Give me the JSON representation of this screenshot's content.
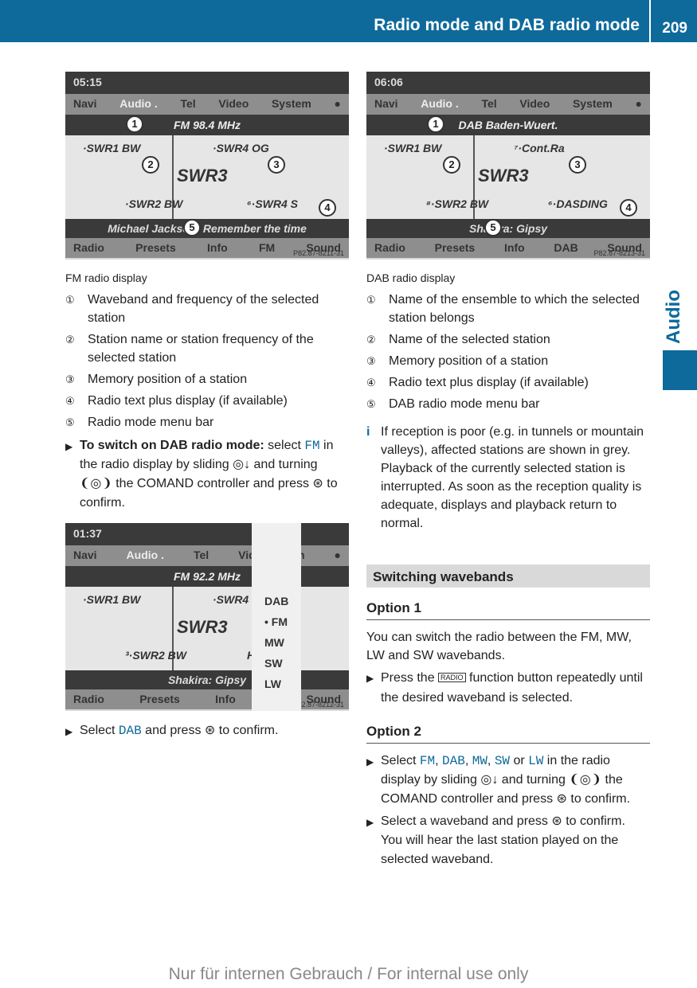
{
  "header": {
    "title": "Radio mode and DAB radio mode",
    "page": "209"
  },
  "side_tab": "Audio",
  "screen_fm": {
    "time": "05:15",
    "nav": [
      "Navi",
      "Audio .",
      "Tel",
      "Video",
      "System"
    ],
    "band": "FM 98.4 MHz",
    "left_top": "·SWR1 BW",
    "right_top": "·SWR4 OG",
    "station": "SWR3",
    "left_bottom": "·SWR2 BW",
    "right_bottom": "⁶·SWR4 S",
    "radiotext": "Michael Jackson: Remember the time",
    "menu": [
      "Radio",
      "Presets",
      "Info",
      "FM",
      "Sound"
    ],
    "code": "P82.87-8211-31"
  },
  "screen_dab": {
    "time": "06:06",
    "nav": [
      "Navi",
      "Audio .",
      "Tel",
      "Video",
      "System"
    ],
    "band": "DAB Baden-Wuert.",
    "left_top": "·SWR1 BW",
    "right_top": "⁷·Cont.Ra",
    "station": "SWR3",
    "left_bottom": "⁸·SWR2 BW",
    "right_bottom": "⁶·DASDING",
    "radiotext": "Shakira: Gipsy",
    "menu": [
      "Radio",
      "Presets",
      "Info",
      "DAB",
      "Sound"
    ],
    "code": "P82.87-8213-31"
  },
  "screen_menu": {
    "time": "01:37",
    "nav": [
      "Navi",
      "Audio .",
      "Tel",
      "Video",
      "n"
    ],
    "band": "FM 92.2 MHz",
    "left_top": "·SWR1 BW",
    "right_top": "·SWR4",
    "station": "SWR3",
    "left_bottom": "³·SWR2 BW",
    "right_bottom": "Hz",
    "radiotext": "Shakira: Gipsy",
    "menu": [
      "Radio",
      "Presets",
      "Info",
      "",
      "Sound"
    ],
    "code": "P82.87-8212-31",
    "dropdown": [
      "DAB",
      "• FM",
      "MW",
      "SW",
      "LW"
    ]
  },
  "callouts": [
    "1",
    "2",
    "3",
    "4",
    "5"
  ],
  "left": {
    "caption": "FM radio display",
    "items": [
      {
        "n": "①",
        "t": "Waveband and frequency of the selected station"
      },
      {
        "n": "②",
        "t": "Station name or station frequency of the selected station"
      },
      {
        "n": "③",
        "t": "Memory position of a station"
      },
      {
        "n": "④",
        "t": "Radio text plus display (if available)"
      },
      {
        "n": "⑤",
        "t": "Radio mode menu bar"
      }
    ],
    "step1": {
      "bold": "To switch on DAB radio mode:",
      "a": " select ",
      "fm": "FM",
      "b": " in the radio display by sliding ◎↓ and turning ❨◎❩ the COMAND controller and press ⊛ to confirm."
    },
    "step2": {
      "a": "Select ",
      "dab": "DAB",
      "b": " and press ⊛ to confirm."
    }
  },
  "right": {
    "caption": "DAB radio display",
    "items": [
      {
        "n": "①",
        "t": "Name of the ensemble to which the selected station belongs"
      },
      {
        "n": "②",
        "t": "Name of the selected station"
      },
      {
        "n": "③",
        "t": "Memory position of a station"
      },
      {
        "n": "④",
        "t": "Radio text plus display (if available)"
      },
      {
        "n": "⑤",
        "t": "DAB radio mode menu bar"
      }
    ],
    "info": "If reception is poor (e.g. in tunnels or mountain valleys), affected stations are shown in grey. Playback of the currently selected station is interrupted. As soon as the reception quality is adequate, displays and playback return to normal.",
    "section": "Switching wavebands",
    "option1": "Option 1",
    "o1_text": "You can switch the radio between the FM, MW, LW and SW wavebands.",
    "o1_step": {
      "a": "Press the ",
      "key": "RADIO",
      "b": " function button repeatedly until the desired waveband is selected."
    },
    "option2": "Option 2",
    "o2_step1": {
      "a": "Select ",
      "fm": "FM",
      ",1": ", ",
      "dab": "DAB",
      "c2": ", ",
      "mw": "MW",
      "c3": ", ",
      "sw": "SW",
      "or": " or ",
      "lw": "LW",
      "b": " in the radio display by sliding ◎↓ and turning ❨◎❩ the COMAND controller and press ⊛ to confirm."
    },
    "o2_step2": "Select a waveband and press ⊛ to confirm. You will hear the last station played on the selected waveband."
  },
  "footer": "Nur für internen Gebrauch / For internal use only",
  "colors": {
    "accent": "#0e6a9b",
    "section_bg": "#d9d9d9"
  }
}
